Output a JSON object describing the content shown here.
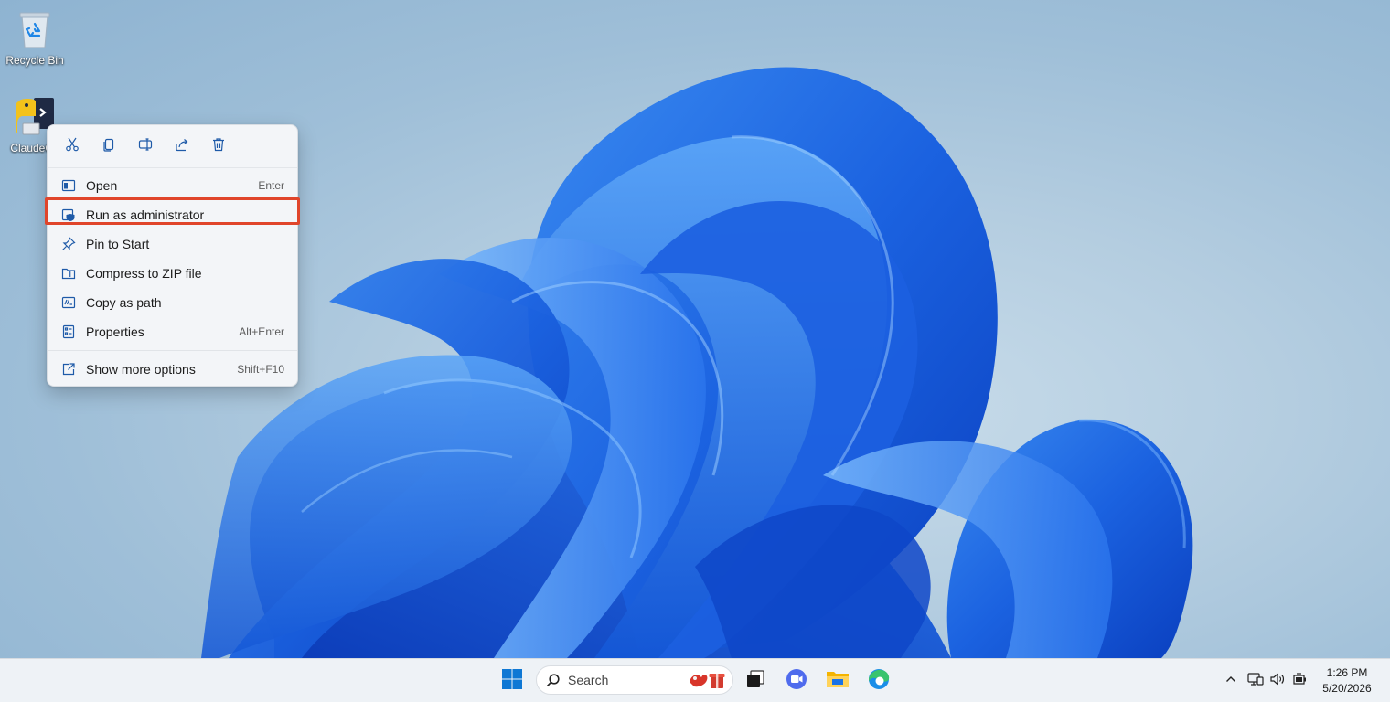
{
  "desktop": {
    "icons": [
      {
        "label": "Recycle Bin",
        "icon": "recycle-bin-icon"
      },
      {
        "label": "ClaudeCo",
        "icon": "python-terminal-icon"
      }
    ]
  },
  "context_menu": {
    "quick_actions": [
      {
        "name": "cut",
        "icon": "scissors-icon"
      },
      {
        "name": "copy",
        "icon": "copy-icon"
      },
      {
        "name": "rename",
        "icon": "rename-icon"
      },
      {
        "name": "share",
        "icon": "share-icon"
      },
      {
        "name": "delete",
        "icon": "trash-icon"
      }
    ],
    "items": [
      {
        "label": "Open",
        "shortcut": "Enter",
        "icon": "open-window-icon"
      },
      {
        "label": "Run as administrator",
        "shortcut": "",
        "icon": "shield-icon",
        "highlighted": true
      },
      {
        "label": "Pin to Start",
        "shortcut": "",
        "icon": "pin-icon"
      },
      {
        "label": "Compress to ZIP file",
        "shortcut": "",
        "icon": "zip-folder-icon"
      },
      {
        "label": "Copy as path",
        "shortcut": "",
        "icon": "copy-path-icon"
      },
      {
        "label": "Properties",
        "shortcut": "Alt+Enter",
        "icon": "properties-icon"
      },
      {
        "label": "Show more options",
        "shortcut": "Shift+F10",
        "icon": "more-options-icon"
      }
    ],
    "highlight_color": "#e0452b"
  },
  "taskbar": {
    "search_placeholder": "Search",
    "apps": [
      {
        "name": "start",
        "icon": "windows-logo-icon"
      },
      {
        "name": "task-view",
        "icon": "task-view-icon"
      },
      {
        "name": "meet",
        "icon": "video-call-icon"
      },
      {
        "name": "file-explorer",
        "icon": "folder-icon"
      },
      {
        "name": "edge",
        "icon": "edge-browser-icon"
      }
    ],
    "tray": {
      "time": "1:26 PM",
      "date": "5/20/2026",
      "icons": [
        "chevron-up-icon",
        "network-icon",
        "volume-icon",
        "battery-icon"
      ]
    }
  },
  "colors": {
    "accent": "#0067c0",
    "wallpaper_blue": "#1a6fe0"
  }
}
